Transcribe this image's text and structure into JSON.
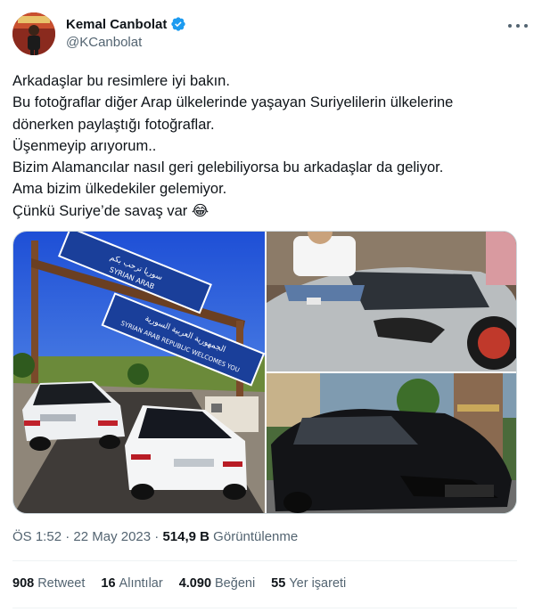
{
  "author": {
    "name": "Kemal Canbolat",
    "handle": "@KCanbolat"
  },
  "tweet": {
    "lines": [
      "Arkadaşlar bu resimlere iyi bakın.",
      "Bu fotoğraflar diğer Arap ülkelerinde yaşayan Suriyelilerin ülkelerine",
      "dönerken paylaştığı fotoğraflar.",
      "Üşenmeyip arıyorum..",
      "Bizim Alamancılar nasıl geri gelebiliyorsa bu arkadaşlar da geliyor.",
      "Ama bizim ülkedekiler gelemiyor.",
      "Çünkü Suriye’de savaş var 😂"
    ]
  },
  "media": {
    "sign_line1": "الجمهورية العربية السورية",
    "sign_line2": "SYRIAN ARAB REPUBLIC WELCOMES YOU",
    "sign_top": "سوريا ترحب بكم",
    "sign_top_en": "SYRIAN ARAB"
  },
  "meta": {
    "time": "ÖS 1:52",
    "sep": " · ",
    "date": "22 May 2023",
    "views": "514,9 B",
    "views_label": " Görüntülenme"
  },
  "stats": [
    {
      "count": "908",
      "label": "Retweet"
    },
    {
      "count": "16",
      "label": "Alıntılar"
    },
    {
      "count": "4.090",
      "label": "Beğeni"
    },
    {
      "count": "55",
      "label": "Yer işareti"
    }
  ],
  "colors": {
    "verified": "#1d9bf0",
    "secondary_text": "#536471",
    "primary_text": "#0f1419"
  }
}
